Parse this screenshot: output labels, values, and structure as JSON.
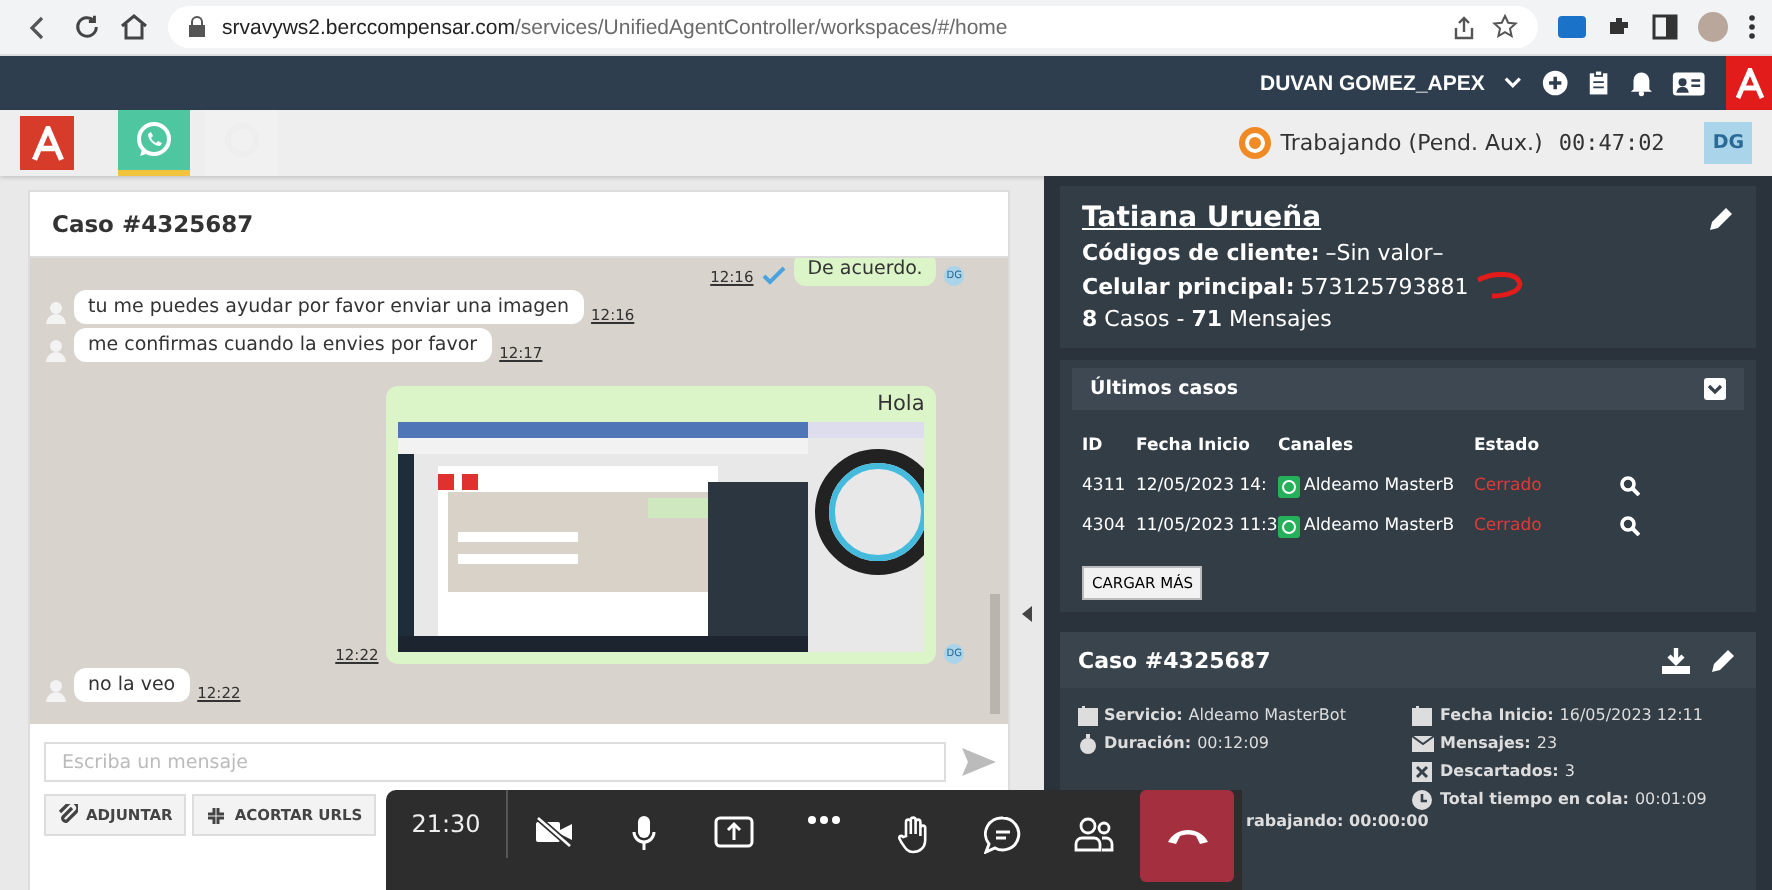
{
  "browser": {
    "url_host": "srvavyws2.berccompensar.com",
    "url_path": "/services/UnifiedAgentController/workspaces/#/home"
  },
  "header": {
    "user": "DUVAN GOMEZ_APEX"
  },
  "appbar": {
    "channels": [
      {
        "kind": "whatsapp",
        "selected": true
      },
      {
        "kind": "other",
        "selected": false
      }
    ],
    "status": "Trabajando (Pend. Aux.)",
    "timer": "00:47:02",
    "avatar": "DG"
  },
  "chat": {
    "title": "Caso #4325687",
    "messages": [
      {
        "kind": "text",
        "outgoing": true,
        "text": "De acuerdo.",
        "time": "12:16",
        "read": true,
        "avatar": "DG"
      },
      {
        "kind": "text",
        "outgoing": false,
        "text": "tu me puedes ayudar por favor enviar una imagen",
        "time": "12:16",
        "read": false
      },
      {
        "kind": "text",
        "outgoing": false,
        "text": "me confirmas cuando la envies por favor",
        "time": "12:17",
        "read": false
      },
      {
        "kind": "image",
        "outgoing": true,
        "text": "Hola",
        "time": "12:22",
        "read": false,
        "avatar": "DG"
      },
      {
        "kind": "text",
        "outgoing": false,
        "text": "no la veo",
        "time": "12:22",
        "read": false
      }
    ],
    "composer": {
      "placeholder": "Escriba un mensaje"
    },
    "tools": [
      {
        "kind": "attach",
        "label": "ADJUNTAR"
      },
      {
        "kind": "shorten",
        "label": "ACORTAR URLS"
      }
    ]
  },
  "client": {
    "name": "Tatiana Urueña",
    "fields": [
      {
        "label": "Códigos de cliente:",
        "value": "–Sin valor–"
      },
      {
        "label": "Celular principal:",
        "value": "573125793881"
      }
    ],
    "stats": "**8** Casos - **71** Mensajes"
  },
  "last_cases": {
    "title": "Últimos casos",
    "columns": [
      "ID",
      "Fecha Inicio",
      "Canales",
      "Estado"
    ],
    "rows": [
      {
        "id": "4311",
        "date": "12/05/2023 14:",
        "channel": "Aldeamo MasterB",
        "status": "Cerrado"
      },
      {
        "id": "4304",
        "date": "11/05/2023 11:3",
        "channel": "Aldeamo MasterB",
        "status": "Cerrado"
      }
    ],
    "button": "CARGAR MÁS"
  },
  "case": {
    "title": "Caso #4325687",
    "left": [
      {
        "label": "Servicio:",
        "value": "Aldeamo MasterBot"
      },
      {
        "label": "Duración:",
        "value": "00:12:09"
      }
    ],
    "right": [
      {
        "label": "Fecha Inicio:",
        "value": "16/05/2023 12:11"
      },
      {
        "label": "Mensajes:",
        "value": "23"
      },
      {
        "label": "Descartados:",
        "value": "3"
      },
      {
        "label": "Total tiempo en cola:",
        "value": "00:01:09"
      }
    ],
    "partial": "rabajando: 00:00:00"
  },
  "call": {
    "time": "21:30"
  }
}
